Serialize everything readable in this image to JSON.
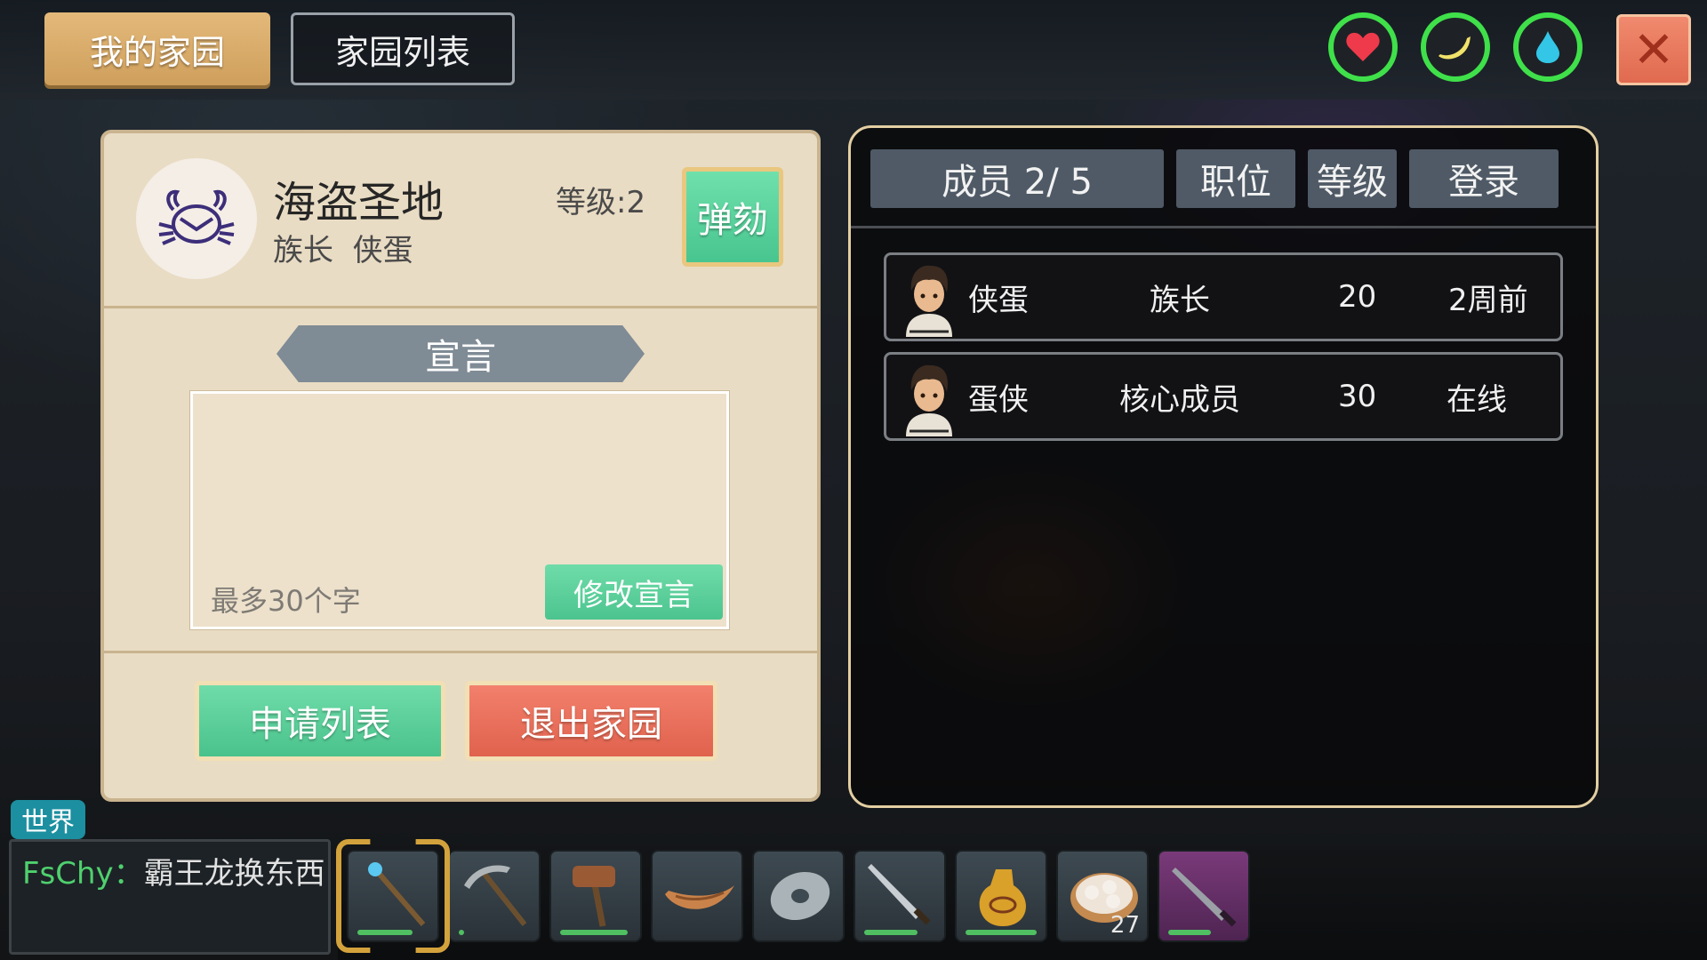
{
  "topbar": {
    "tab_mine": "我的家园",
    "tab_list": "家园列表",
    "stats": [
      {
        "icon": "heart-icon",
        "color": "#ef3a4b"
      },
      {
        "icon": "banana-icon",
        "color": "#f1e26a"
      },
      {
        "icon": "water-drop-icon",
        "color": "#33c6e6"
      }
    ],
    "close_label": "✕"
  },
  "clan": {
    "name": "海盗圣地",
    "leader_line": "族长  侠蛋",
    "level": "等级:2",
    "impeach_label": "弹劾",
    "declaration_title": "宣言",
    "declaration_placeholder": "最多30个字",
    "edit_declaration_label": "修改宣言",
    "apply_list_label": "申请列表",
    "quit_label": "退出家园"
  },
  "members": {
    "headers": [
      "成员 2/ 5",
      "职位",
      "等级",
      "登录"
    ],
    "rows": [
      {
        "name": "侠蛋",
        "role": "族长",
        "level": "20",
        "login": "2周前"
      },
      {
        "name": "蛋侠",
        "role": "核心成员",
        "level": "30",
        "login": "在线"
      }
    ]
  },
  "chat": {
    "channel": "世界",
    "user": "FsChy：",
    "message": "霸王龙换东西"
  },
  "hotbar": {
    "slots": [
      {
        "item": "staff-icon",
        "durability": 0.62,
        "selected": true
      },
      {
        "item": "pickaxe-icon",
        "durability": 0.05
      },
      {
        "item": "hammer-icon",
        "durability": 0.78
      },
      {
        "item": "boat-icon"
      },
      {
        "item": "shield-stone-icon"
      },
      {
        "item": "sword-icon",
        "durability": 0.6
      },
      {
        "item": "flask-icon",
        "durability": 0.9
      },
      {
        "item": "dumpling-basket-icon",
        "count": "27"
      },
      {
        "item": "dark-sword-icon",
        "durability": 0.5
      }
    ]
  }
}
